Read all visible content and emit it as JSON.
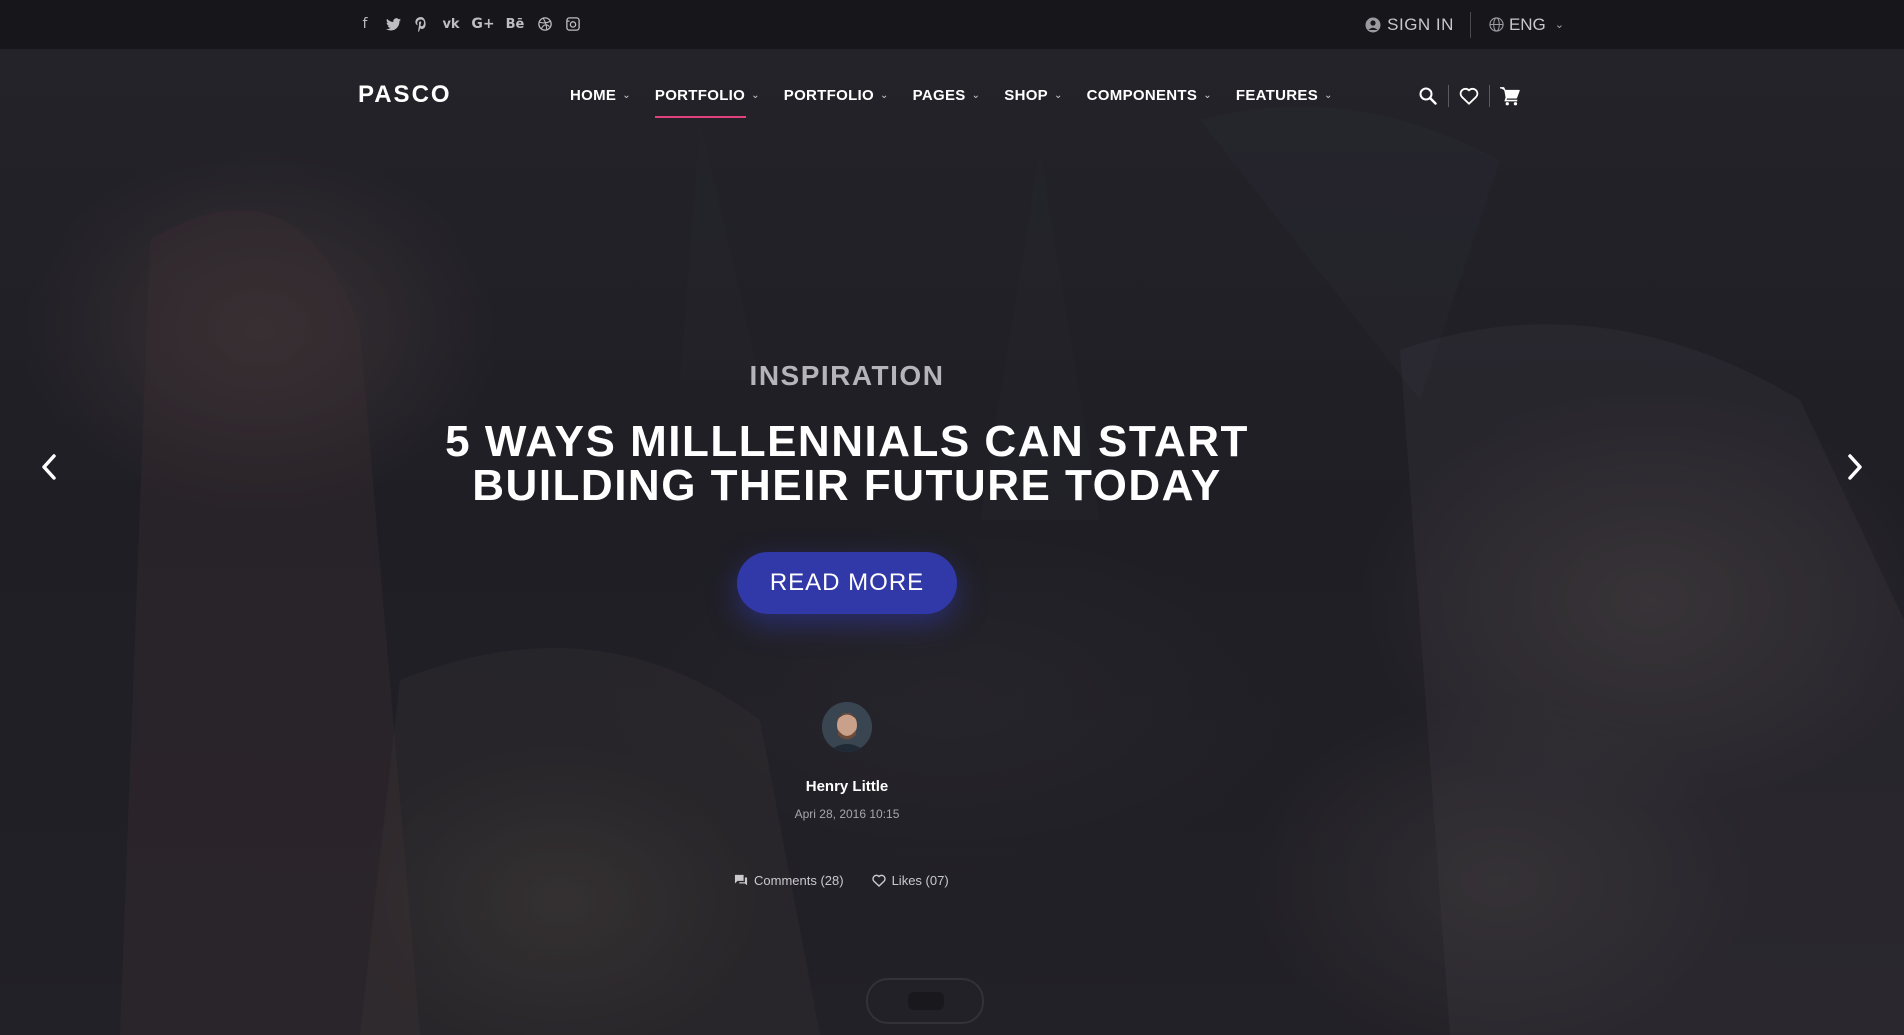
{
  "topbar": {
    "social_icons": [
      "facebook-icon",
      "twitter-icon",
      "pinterest-icon",
      "vk-icon",
      "google-plus-icon",
      "behance-icon",
      "dribbble-icon",
      "instagram-icon"
    ],
    "social_glyphs": [
      "f",
      "🐦",
      "℗",
      "vk",
      "G+",
      "Bē",
      "◎",
      "◻"
    ],
    "signin_label": "SIGN IN",
    "language_label": "ENG"
  },
  "nav": {
    "logo": "PASCO",
    "items": [
      {
        "label": "HOME"
      },
      {
        "label": "PORTFOLIO"
      },
      {
        "label": "PORTFOLIO"
      },
      {
        "label": "PAGES"
      },
      {
        "label": "SHOP"
      },
      {
        "label": "COMPONENTS"
      },
      {
        "label": "FEATURES"
      }
    ],
    "active_index": 1
  },
  "hero": {
    "category": "INSPIRATION",
    "title_line1": "5 WAYS MILLLENNIALS CAN START",
    "title_line2": "BUILDING THEIR FUTURE TODAY",
    "button_label": "READ MORE",
    "author_name": "Henry Little",
    "date": "Apri 28, 2016 10:15",
    "comments_label": "Comments (28)",
    "likes_label": "Likes (07)"
  },
  "colors": {
    "accent_underline": "#e0427a",
    "button": "#3138a8",
    "topbar_bg": "#17171b"
  }
}
